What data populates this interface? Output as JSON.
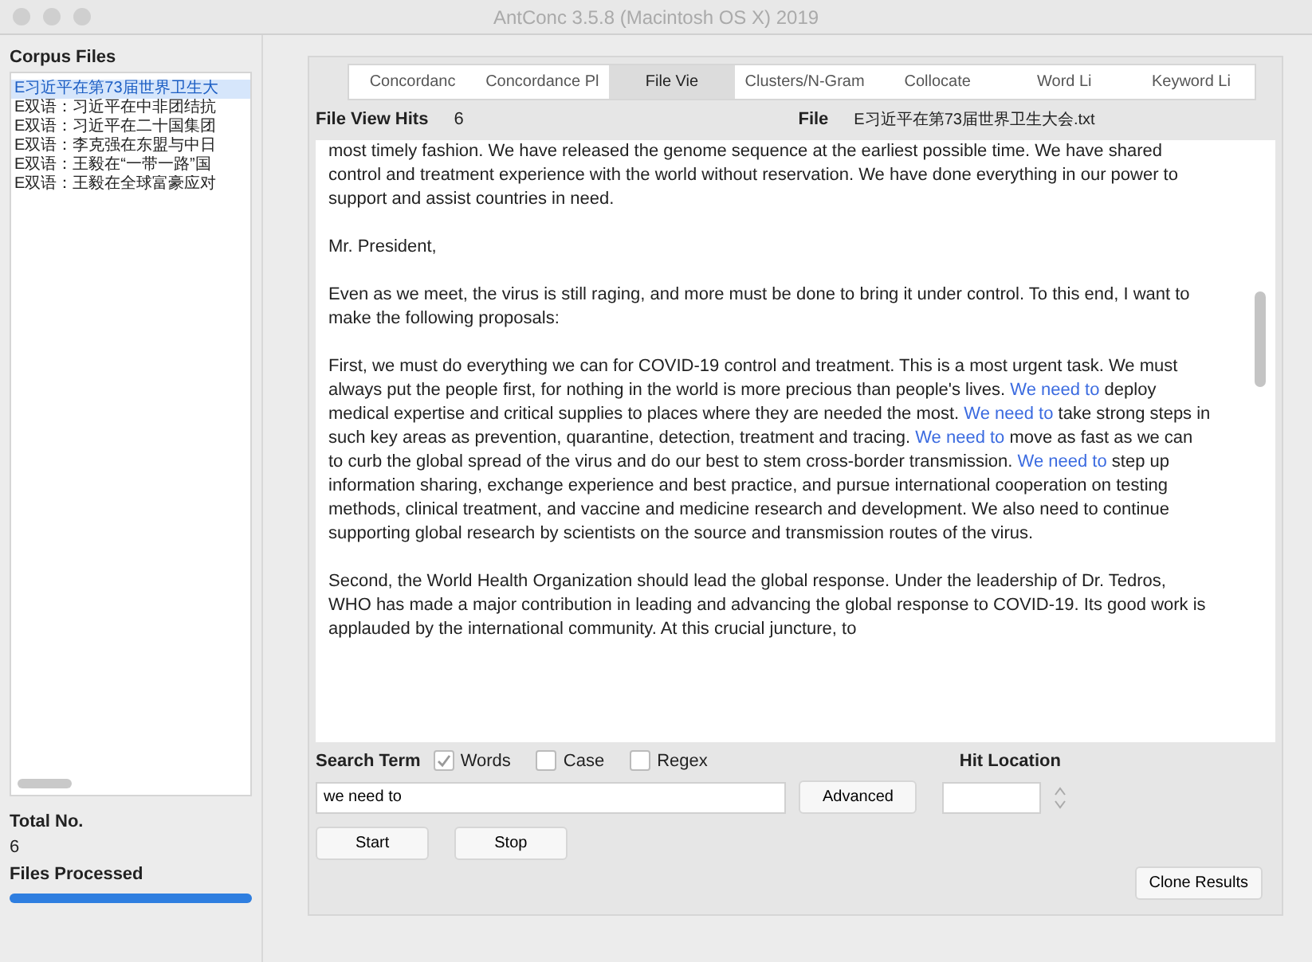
{
  "window": {
    "title": "AntConc 3.5.8 (Macintosh OS X) 2019"
  },
  "sidebar": {
    "title": "Corpus Files",
    "files": [
      {
        "name": "E习近平在第73届世界卫生大",
        "selected": true
      },
      {
        "name": "E双语：习近平在中非团结抗",
        "selected": false
      },
      {
        "name": "E双语：习近平在二十国集团",
        "selected": false
      },
      {
        "name": "E双语：李克强在东盟与中日",
        "selected": false
      },
      {
        "name": "E双语：王毅在“一带一路”国",
        "selected": false
      },
      {
        "name": "E双语：王毅在全球富豪应对",
        "selected": false
      }
    ],
    "total_label": "Total No.",
    "total": "6",
    "processed_label": "Files Processed",
    "progress": {
      "level": 1
    }
  },
  "tabs": [
    {
      "label": "Concordanc",
      "selected": false
    },
    {
      "label": "Concordance Pl",
      "selected": false
    },
    {
      "label": "File Vie",
      "selected": true
    },
    {
      "label": "Clusters/N-Gram",
      "selected": false
    },
    {
      "label": "Collocate",
      "selected": false
    },
    {
      "label": "Word Li",
      "selected": false
    },
    {
      "label": "Keyword Li",
      "selected": false
    }
  ],
  "file_view": {
    "hits_label": "File View Hits",
    "hits": "6",
    "file_label": "File",
    "file": "E习近平在第73届世界卫生大会.txt",
    "paragraphs": [
      [
        {
          "text": "most timely fashion. We have released the genome sequence at the earliest possible time. We have shared control and treatment experience with the world without reservation. We have done everything in our power to support and assist countries in need."
        }
      ],
      [
        {
          "text": "Mr. President,"
        }
      ],
      [
        {
          "text": "Even as we meet, the virus is still raging, and more must be done to bring it under control. To this end, I want to make the following proposals:"
        }
      ],
      [
        {
          "text": "First, we must do everything we can for COVID-19 control and treatment. This is a most urgent task. We must always put the people first, for nothing in the world is more precious than people's lives. "
        },
        {
          "text": "We need to",
          "hit": true
        },
        {
          "text": " deploy medical expertise and critical supplies to places where they are needed the most. "
        },
        {
          "text": "We need to",
          "hit": true
        },
        {
          "text": " take strong steps in such key areas as prevention, quarantine, detection, treatment and tracing. "
        },
        {
          "text": "We need to",
          "hit": true
        },
        {
          "text": " move as fast as we can to curb the global spread of the virus and do our best to stem cross-border transmission. "
        },
        {
          "text": "We need to",
          "hit": true
        },
        {
          "text": " step up information sharing, exchange experience and best practice, and pursue international cooperation on testing methods, clinical treatment, and vaccine and medicine research and development. We also need to continue supporting global research by scientists on the source and transmission routes of the virus."
        }
      ],
      [
        {
          "text": "Second, the World Health Organization should lead the global response. Under the leadership of Dr. Tedros, WHO has made a major contribution in leading and advancing the global response to COVID-19. Its good work is applauded by the international community. At this crucial juncture, to"
        }
      ]
    ]
  },
  "search": {
    "label": "Search Term",
    "options": [
      {
        "label": "Words",
        "checked": true
      },
      {
        "label": "Case",
        "checked": false
      },
      {
        "label": "Regex",
        "checked": false
      }
    ],
    "value": "we need to",
    "advanced": "Advanced",
    "hit_location_label": "Hit Location",
    "start": "Start",
    "stop": "Stop",
    "clone": "Clone Results"
  }
}
